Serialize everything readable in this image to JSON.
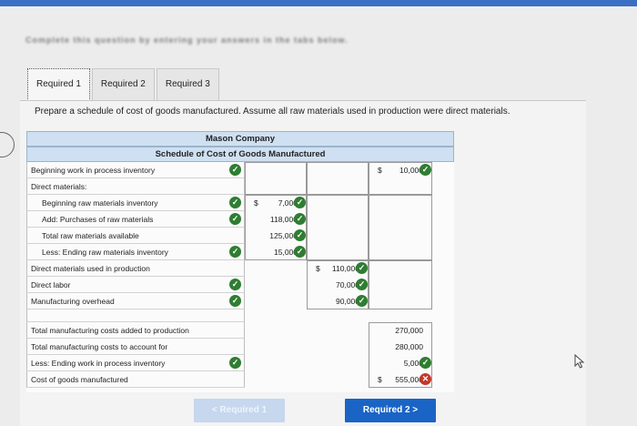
{
  "instruction": "Complete this question by entering your answers in the tabs below.",
  "tabs": [
    {
      "label": "Required 1",
      "active": true
    },
    {
      "label": "Required 2",
      "active": false
    },
    {
      "label": "Required 3",
      "active": false
    }
  ],
  "prompt": "Prepare a schedule of cost of goods manufactured. Assume all raw materials used in production were direct materials.",
  "schedule": {
    "company": "Mason Company",
    "title": "Schedule of Cost of Goods Manufactured",
    "rows": {
      "beginning_wip": {
        "label": "Beginning work in process inventory",
        "value": "10,000"
      },
      "direct_materials": {
        "label": "Direct materials:"
      },
      "beginning_raw": {
        "label": "Beginning raw materials inventory",
        "value": "7,000"
      },
      "purchases": {
        "label": "Add: Purchases of raw materials",
        "value": "118,000"
      },
      "total_raw": {
        "label": "Total raw materials available",
        "value": "125,000"
      },
      "ending_raw": {
        "label": "Less: Ending raw materials inventory",
        "value": "15,000"
      },
      "dm_used": {
        "label": "Direct materials used in production",
        "value": "110,000"
      },
      "direct_labor": {
        "label": "Direct labor",
        "value": "70,000"
      },
      "overhead": {
        "label": "Manufacturing overhead",
        "value": "90,000"
      },
      "total_added": {
        "label": "Total manufacturing costs added to production",
        "value": "270,000"
      },
      "total_account": {
        "label": "Total manufacturing costs to account for",
        "value": "280,000"
      },
      "ending_wip": {
        "label": "Less: Ending work in process inventory",
        "value": "5,000"
      },
      "cogm": {
        "label": "Cost of goods manufactured",
        "value": "555,000"
      }
    },
    "dollar_sign": "$"
  },
  "nav": {
    "prev_label": "< Required 1",
    "next_label": "Required 2 >"
  },
  "colors": {
    "accent": "#1a64c6",
    "header_bg": "#cfe0f2",
    "correct": "#2f7d32",
    "incorrect": "#c0392b"
  }
}
